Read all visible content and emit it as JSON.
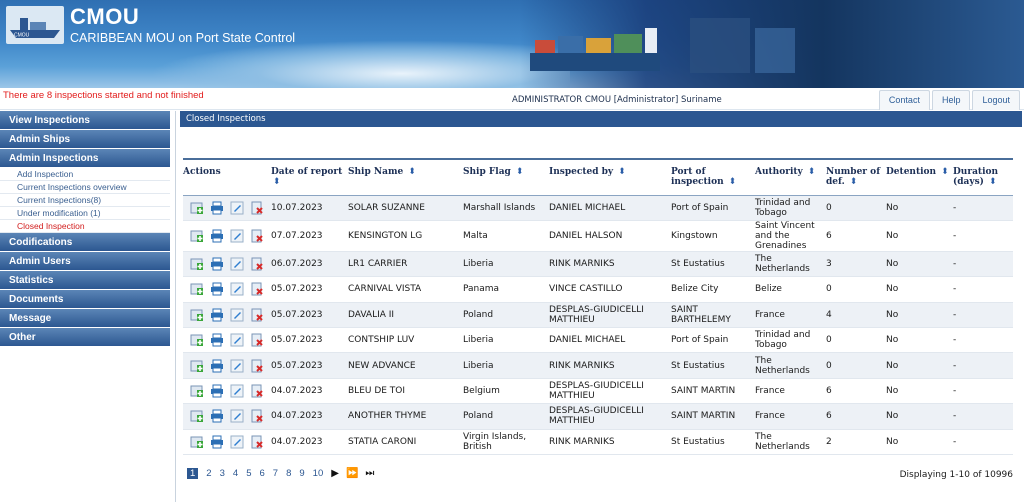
{
  "header": {
    "title": "CMOU",
    "subtitle": "CARIBBEAN MOU on Port State Control",
    "logo_text": "CMOU"
  },
  "topbar": {
    "warning": "There are 8 inspections started and not finished",
    "user": "ADMINISTRATOR CMOU [Administrator] Suriname",
    "links": [
      "Contact",
      "Help",
      "Logout"
    ]
  },
  "sidebar": {
    "view_inspections": "View Inspections",
    "admin_ships": "Admin Ships",
    "admin_inspections": "Admin Inspections",
    "sub": {
      "add": "Add Inspection",
      "overview": "Current Inspections overview",
      "current": "Current Inspections(8)",
      "under_mod": "Under modification (1)",
      "closed": "Closed Inspection"
    },
    "codifications": "Codifications",
    "admin_users": "Admin Users",
    "statistics": "Statistics",
    "documents": "Documents",
    "message": "Message",
    "other": "Other"
  },
  "panel": {
    "title": "Closed Inspections"
  },
  "table": {
    "headers": {
      "actions": "Actions",
      "date": "Date of report",
      "ship": "Ship Name",
      "flag": "Ship Flag",
      "by": "Inspected by",
      "port": "Port of inspection",
      "authority": "Authority",
      "def": "Number of def.",
      "detention": "Detention",
      "duration": "Duration (days)"
    },
    "rows": [
      {
        "date": "10.07.2023",
        "ship": "SOLAR SUZANNE",
        "flag": "Marshall Islands",
        "by": "DANIEL MICHAEL",
        "port": "Port of Spain",
        "authority": "Trinidad and Tobago",
        "def": "0",
        "detention": "No",
        "duration": "-"
      },
      {
        "date": "07.07.2023",
        "ship": "KENSINGTON LG",
        "flag": "Malta",
        "by": "DANIEL HALSON",
        "port": "Kingstown",
        "authority": "Saint Vincent and the Grenadines",
        "def": "6",
        "detention": "No",
        "duration": "-"
      },
      {
        "date": "06.07.2023",
        "ship": "LR1 CARRIER",
        "flag": "Liberia",
        "by": "RINK MARNIKS",
        "port": "St Eustatius",
        "authority": "The Netherlands",
        "def": "3",
        "detention": "No",
        "duration": "-"
      },
      {
        "date": "05.07.2023",
        "ship": "CARNIVAL VISTA",
        "flag": "Panama",
        "by": "VINCE CASTILLO",
        "port": "Belize City",
        "authority": "Belize",
        "def": "0",
        "detention": "No",
        "duration": "-"
      },
      {
        "date": "05.07.2023",
        "ship": "DAVALIA II",
        "flag": "Poland",
        "by": "DESPLAS-GIUDICELLI MATTHIEU",
        "port": "SAINT BARTHELEMY",
        "authority": "France",
        "def": "4",
        "detention": "No",
        "duration": "-"
      },
      {
        "date": "05.07.2023",
        "ship": "CONTSHIP LUV",
        "flag": "Liberia",
        "by": "DANIEL MICHAEL",
        "port": "Port of Spain",
        "authority": "Trinidad and Tobago",
        "def": "0",
        "detention": "No",
        "duration": "-"
      },
      {
        "date": "05.07.2023",
        "ship": "NEW ADVANCE",
        "flag": "Liberia",
        "by": "RINK MARNIKS",
        "port": "St Eustatius",
        "authority": "The Netherlands",
        "def": "0",
        "detention": "No",
        "duration": "-"
      },
      {
        "date": "04.07.2023",
        "ship": "BLEU DE TOI",
        "flag": "Belgium",
        "by": "DESPLAS-GIUDICELLI MATTHIEU",
        "port": "SAINT MARTIN",
        "authority": "France",
        "def": "6",
        "detention": "No",
        "duration": "-"
      },
      {
        "date": "04.07.2023",
        "ship": "ANOTHER THYME",
        "flag": "Poland",
        "by": "DESPLAS-GIUDICELLI MATTHIEU",
        "port": "SAINT MARTIN",
        "authority": "France",
        "def": "6",
        "detention": "No",
        "duration": "-"
      },
      {
        "date": "04.07.2023",
        "ship": "STATIA CARONI",
        "flag": "Virgin Islands, British",
        "by": "RINK MARNIKS",
        "port": "St Eustatius",
        "authority": "The Netherlands",
        "def": "2",
        "detention": "No",
        "duration": "-"
      }
    ]
  },
  "pager": {
    "pages": [
      "1",
      "2",
      "3",
      "4",
      "5",
      "6",
      "7",
      "8",
      "9",
      "10"
    ],
    "current": "1",
    "display": "Displaying 1-10 of 10996"
  },
  "icons": [
    "add-icon",
    "print-icon",
    "edit-icon",
    "delete-icon",
    "sort-icon",
    "next-icon",
    "fast-forward-icon",
    "last-page-icon"
  ],
  "colors": {
    "nav": "#2c5791",
    "warning": "#e21b1b",
    "row_alt": "#edf1f6"
  }
}
